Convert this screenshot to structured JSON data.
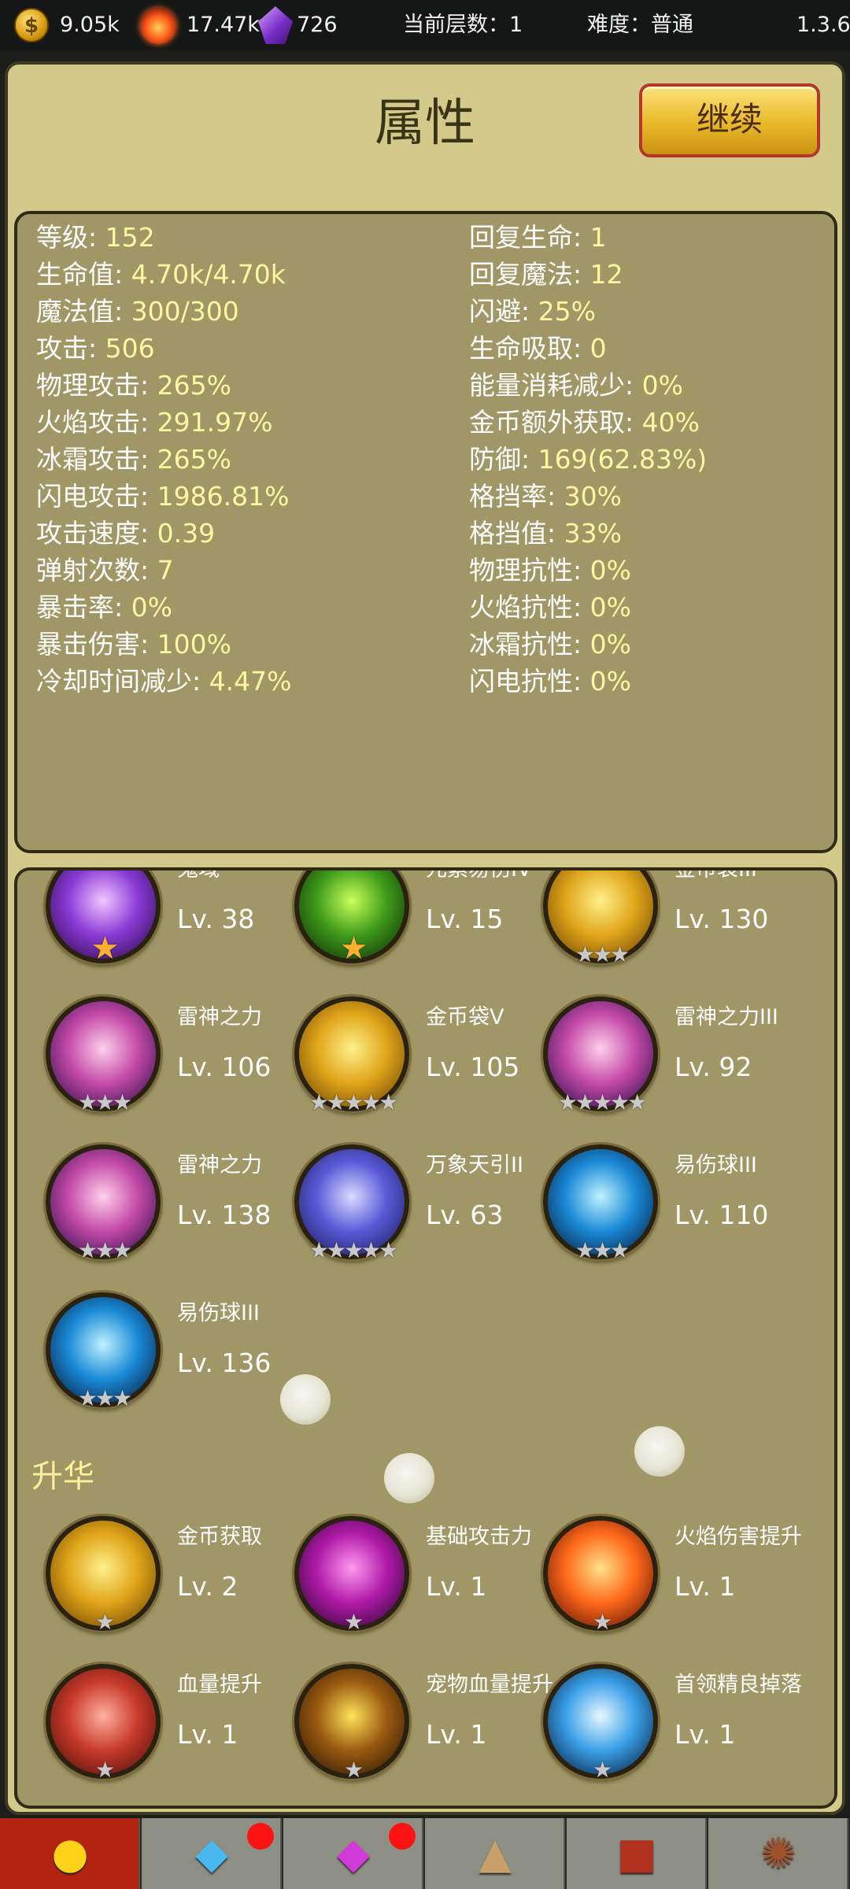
{
  "topbar": {
    "coins": "9.05k",
    "coin_icon_glyph": "$",
    "fire": "17.47k",
    "gems": "726",
    "floor_label": "当前层数：1",
    "difficulty_label": "难度：普通",
    "version": "1.3.6"
  },
  "header": {
    "title": "属性",
    "continue_label": "继续"
  },
  "stats_left": [
    {
      "label": "等级: ",
      "value": "152"
    },
    {
      "label": "生命值: ",
      "value": "4.70k/4.70k"
    },
    {
      "label": "魔法值: ",
      "value": "300/300"
    },
    {
      "label": "攻击: ",
      "value": "506"
    },
    {
      "label": "物理攻击: ",
      "value": "265%"
    },
    {
      "label": "火焰攻击: ",
      "value": "291.97%"
    },
    {
      "label": "冰霜攻击: ",
      "value": "265%"
    },
    {
      "label": "闪电攻击: ",
      "value": "1986.81%"
    },
    {
      "label": "攻击速度: ",
      "value": "0.39"
    },
    {
      "label": "弹射次数: ",
      "value": "7"
    },
    {
      "label": "暴击率: ",
      "value": "0%"
    },
    {
      "label": "暴击伤害: ",
      "value": "100%"
    },
    {
      "label": "冷却时间减少: ",
      "value": "4.47%"
    }
  ],
  "stats_right": [
    {
      "label": "回复生命: ",
      "value": "1"
    },
    {
      "label": "回复魔法: ",
      "value": "12"
    },
    {
      "label": "闪避: ",
      "value": "25%"
    },
    {
      "label": "生命吸取: ",
      "value": "0"
    },
    {
      "label": "能量消耗减少: ",
      "value": "0%"
    },
    {
      "label": "金币额外获取: ",
      "value": "40%"
    },
    {
      "label": "防御: ",
      "value": "169(62.83%)"
    },
    {
      "label": "格挡率: ",
      "value": "30%"
    },
    {
      "label": "格挡值: ",
      "value": "33%"
    },
    {
      "label": "物理抗性: ",
      "value": "0%"
    },
    {
      "label": "火焰抗性: ",
      "value": "0%"
    },
    {
      "label": "冰霜抗性: ",
      "value": "0%"
    },
    {
      "label": "闪电抗性: ",
      "value": "0%"
    }
  ],
  "skills": [
    {
      "name": "鬼域",
      "level": "Lv. 38",
      "stars": "★",
      "star_style": "gold",
      "icon": "ghost-domain-icon",
      "colors": [
        "#f2c6ff",
        "#8a3ad6",
        "#2a0a44"
      ]
    },
    {
      "name": "元素易伤IV",
      "level": "Lv. 15",
      "stars": "★",
      "star_style": "gold",
      "icon": "skull-icon",
      "colors": [
        "#c9ff5a",
        "#3f9a1a",
        "#0d2a06"
      ]
    },
    {
      "name": "金币袋III",
      "level": "Lv. 130",
      "stars": "★★★",
      "star_style": "silver",
      "icon": "coin-bag-icon",
      "colors": [
        "#fff08a",
        "#e0a51a",
        "#6a4200"
      ]
    },
    {
      "name": "雷神之力",
      "level": "Lv. 106",
      "stars": "★★★",
      "star_style": "silver",
      "icon": "galaxy-icon",
      "colors": [
        "#ffd0ec",
        "#c44aa8",
        "#2a0c4a"
      ]
    },
    {
      "name": "金币袋V",
      "level": "Lv. 105",
      "stars": "★★★★★",
      "star_style": "silver",
      "icon": "coin-bag-icon",
      "colors": [
        "#fff08a",
        "#e0a51a",
        "#6a4200"
      ]
    },
    {
      "name": "雷神之力III",
      "level": "Lv. 92",
      "stars": "★★★★★",
      "star_style": "silver",
      "icon": "galaxy-icon",
      "colors": [
        "#ffd0ec",
        "#c44aa8",
        "#2a0c4a"
      ]
    },
    {
      "name": "雷神之力",
      "level": "Lv. 138",
      "stars": "★★★",
      "star_style": "silver",
      "icon": "galaxy-icon",
      "colors": [
        "#ffd0ec",
        "#c44aa8",
        "#2a0c4a"
      ]
    },
    {
      "name": "万象天引II",
      "level": "Lv. 63",
      "stars": "★★★★★",
      "star_style": "silver",
      "icon": "spiral-icon",
      "colors": [
        "#d8dcff",
        "#5a5ad8",
        "#1a1a5a"
      ]
    },
    {
      "name": "易伤球III",
      "level": "Lv. 110",
      "stars": "★★★",
      "star_style": "silver",
      "icon": "blade-orb-icon",
      "colors": [
        "#bff2ff",
        "#1a8ad6",
        "#06183a"
      ]
    },
    {
      "name": "易伤球III",
      "level": "Lv. 136",
      "stars": "★★★",
      "star_style": "silver",
      "icon": "blade-orb-icon",
      "colors": [
        "#bff2ff",
        "#1a8ad6",
        "#06183a"
      ]
    }
  ],
  "ascension": {
    "title": "升华",
    "items": [
      {
        "name": "金币获取",
        "level": "Lv. 2",
        "stars": "★",
        "icon": "coin-bag-icon",
        "colors": [
          "#fff08a",
          "#e0a51a",
          "#6a4200"
        ]
      },
      {
        "name": "基础攻击力",
        "level": "Lv. 1",
        "stars": "★",
        "icon": "claw-icon",
        "colors": [
          "#ff9af0",
          "#b01aa8",
          "#2a0630"
        ]
      },
      {
        "name": "火焰伤害提升",
        "level": "Lv. 1",
        "stars": "★",
        "icon": "flame-slash-icon",
        "colors": [
          "#ffe08a",
          "#ff6a1a",
          "#5a0e06"
        ]
      },
      {
        "name": "血量提升",
        "level": "Lv. 1",
        "stars": "★",
        "icon": "meat-icon",
        "colors": [
          "#ffb0a0",
          "#c83a2a",
          "#4a0e0a"
        ]
      },
      {
        "name": "宠物血量提升",
        "level": "Lv. 1",
        "stars": "★",
        "icon": "lava-rock-icon",
        "colors": [
          "#ffe25a",
          "#9a5a10",
          "#2a1404"
        ]
      },
      {
        "name": "首领精良掉落",
        "level": "Lv. 1",
        "stars": "★",
        "icon": "cat-silhouette-icon",
        "colors": [
          "#e8f8ff",
          "#3aa0e8",
          "#061a3a"
        ]
      }
    ]
  },
  "nav": [
    {
      "name": "tab-attributes",
      "icon": "character-icon",
      "active": true,
      "badge": false
    },
    {
      "name": "tab-crystal",
      "icon": "crystal-icon",
      "active": false,
      "badge": true
    },
    {
      "name": "tab-gem",
      "icon": "purple-crystal-icon",
      "active": false,
      "badge": true
    },
    {
      "name": "tab-forge",
      "icon": "anvil-icon",
      "active": false,
      "badge": false
    },
    {
      "name": "tab-book",
      "icon": "spellbook-icon",
      "active": false,
      "badge": false
    },
    {
      "name": "tab-settings",
      "icon": "gear-icon",
      "active": false,
      "badge": false
    }
  ]
}
